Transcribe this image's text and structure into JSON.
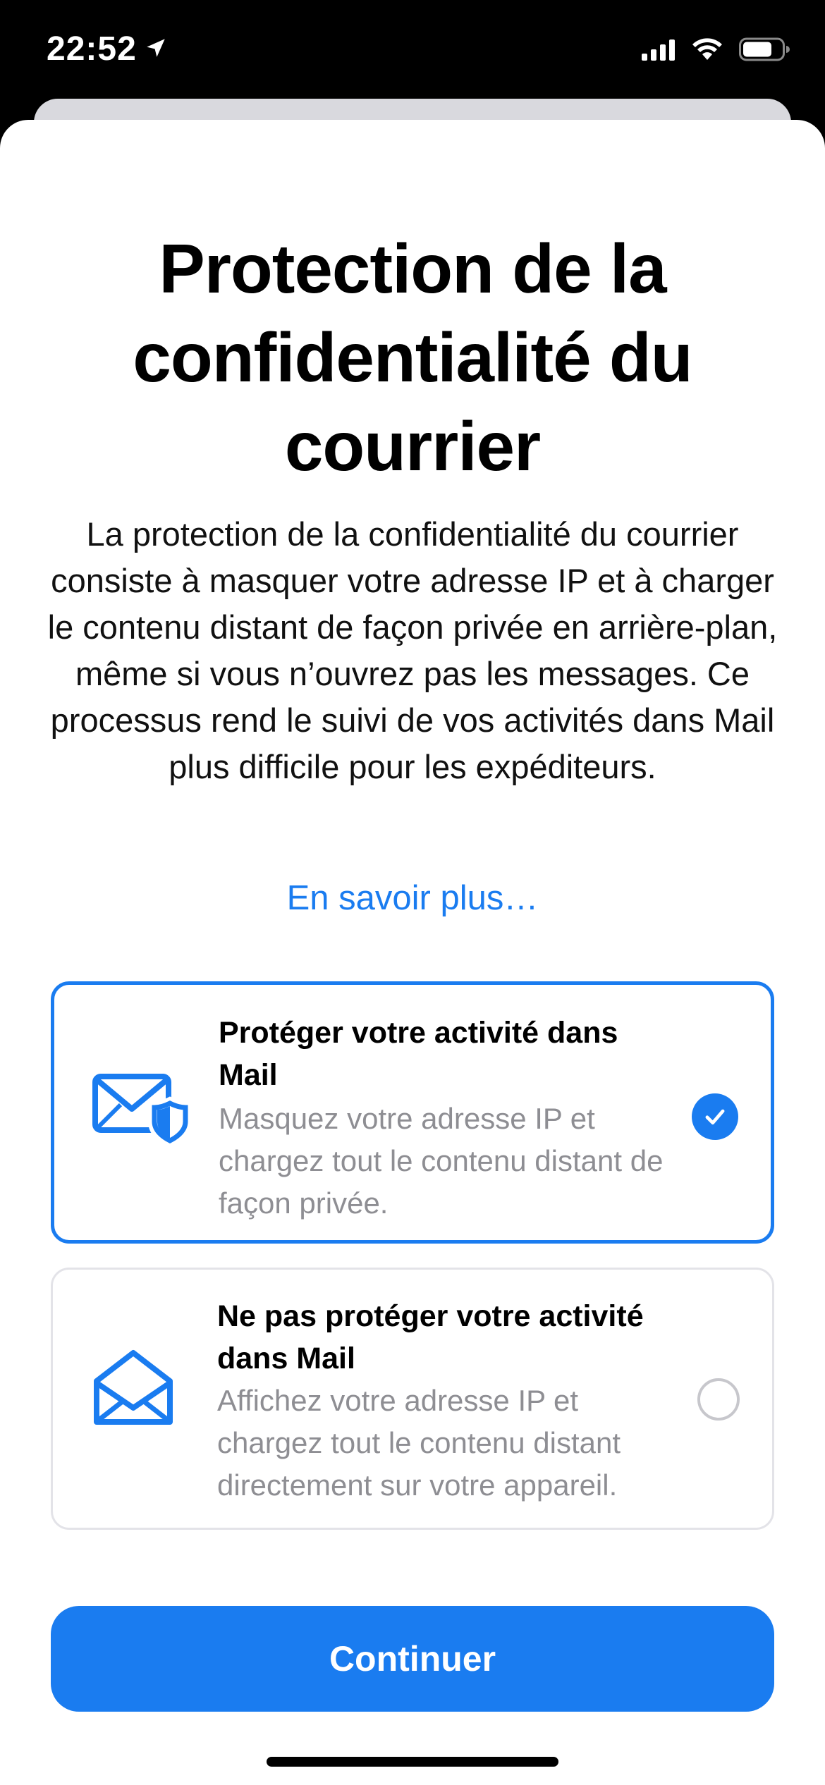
{
  "status_bar": {
    "time": "22:52",
    "icons": [
      "location-arrow-icon",
      "cellular-signal-icon",
      "wifi-icon",
      "battery-icon"
    ]
  },
  "sheet": {
    "title": "Protection de la confidentialité du courrier",
    "description": "La protection de la confidentialité du courrier consiste à masquer votre adresse IP et à charger le contenu distant de façon privée en arrière-plan, même si vous n’ouvrez pas les messages. Ce processus rend le suivi de vos activités dans Mail plus difficile pour les expéditeurs.",
    "learn_more": "En savoir plus…",
    "options": [
      {
        "title": "Protéger votre activité dans Mail",
        "subtitle": "Masquez votre adresse IP et chargez tout le contenu distant de façon privée.",
        "icon": "mail-shield-icon",
        "selected": true
      },
      {
        "title": "Ne pas protéger votre activité dans Mail",
        "subtitle": "Affichez votre adresse IP et chargez tout le contenu distant directement sur votre appareil.",
        "icon": "open-envelope-icon",
        "selected": false
      }
    ],
    "continue_label": "Continuer"
  },
  "colors": {
    "accent": "#1a7cf0",
    "secondary_text": "#8e8e93",
    "status_bar_bg": "#000000"
  }
}
